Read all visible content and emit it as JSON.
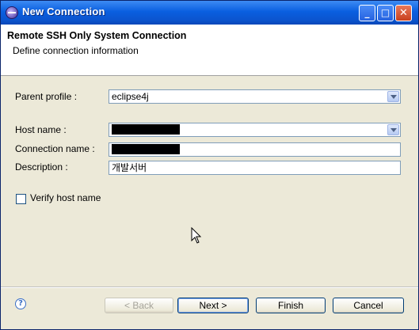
{
  "window": {
    "title": "New Connection"
  },
  "titlebar_buttons": {
    "minimize": "_",
    "maximize": "□",
    "close": "✕"
  },
  "header": {
    "title": "Remote SSH Only System Connection",
    "subtitle": "Define connection information"
  },
  "form": {
    "parent_profile": {
      "label": "Parent profile :",
      "value": "eclipse4j"
    },
    "host_name": {
      "label": "Host name :"
    },
    "connection_name": {
      "label": "Connection name :"
    },
    "description": {
      "label": "Description :",
      "value": "개발서버"
    },
    "verify_host": {
      "label": "Verify host name",
      "checked": false
    }
  },
  "footer": {
    "help_glyph": "?",
    "back": "< Back",
    "next": "Next >",
    "finish": "Finish",
    "cancel": "Cancel"
  }
}
